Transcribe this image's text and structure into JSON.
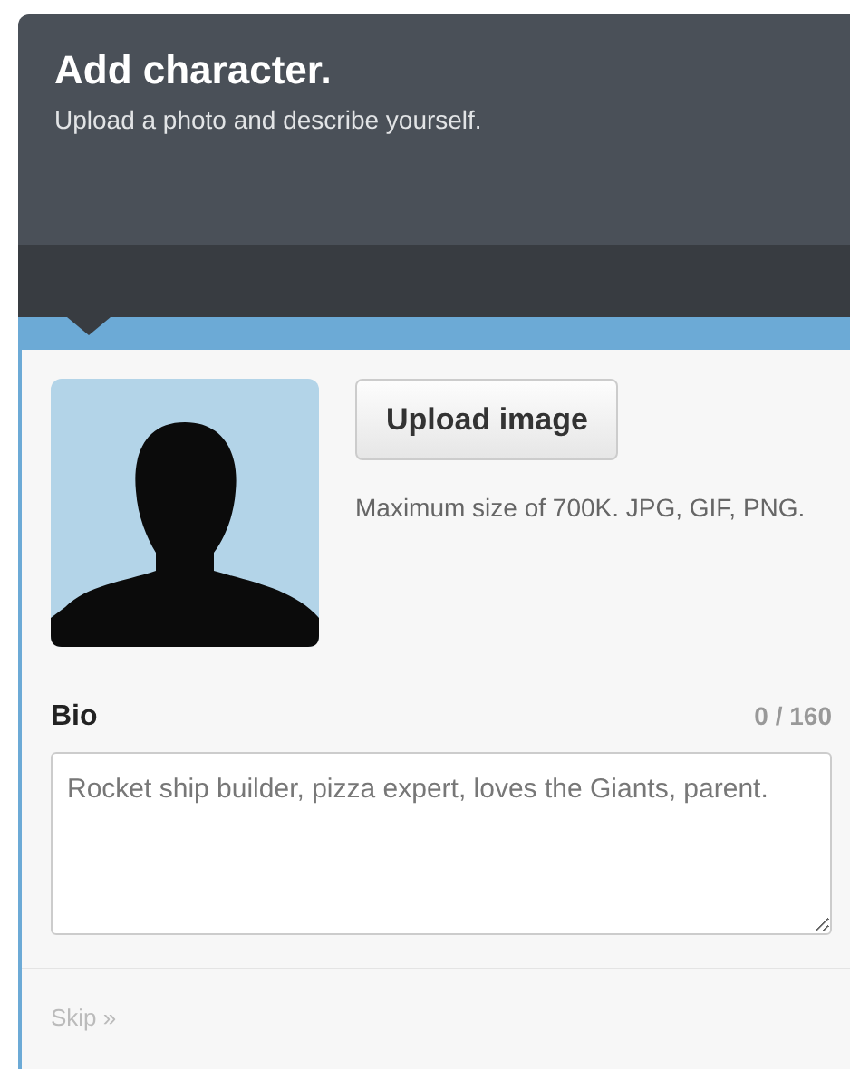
{
  "header": {
    "title": "Add character.",
    "subtitle": "Upload a photo and describe yourself."
  },
  "photo": {
    "kind": "avatar"
  },
  "upload_button": "Upload image",
  "upload_hint": "Maximum size of 700K. JPG, GIF, PNG.",
  "bio": {
    "label": "Bio",
    "counter": "0 / 160",
    "placeholder": "Rocket ship builder, pizza expert, loves the Giants, parent."
  },
  "skip_link": "Skip »"
}
